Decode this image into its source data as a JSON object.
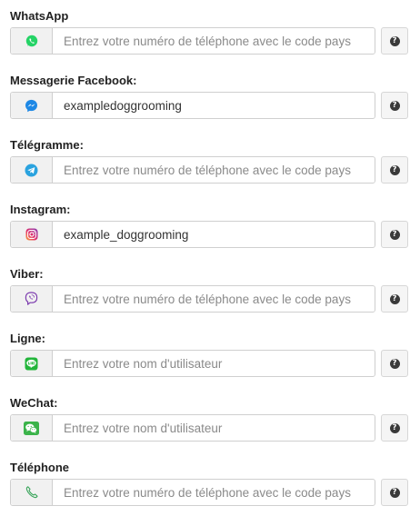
{
  "help_glyph": "?",
  "fields": [
    {
      "label": "WhatsApp",
      "icon": "whatsapp-icon",
      "icon_color": "#25D366",
      "value": "",
      "placeholder": "Entrez votre numéro de téléphone avec le code pays"
    },
    {
      "label": "Messagerie Facebook:",
      "icon": "messenger-icon",
      "icon_color": "#1E88E5",
      "value": "exampledoggrooming",
      "placeholder": ""
    },
    {
      "label": "Télégramme:",
      "icon": "telegram-icon",
      "icon_color": "#2AA3DF",
      "value": "",
      "placeholder": "Entrez votre numéro de téléphone avec le code pays"
    },
    {
      "label": "Instagram:",
      "icon": "instagram-icon",
      "icon_color": "#D6336C",
      "value": "example_doggrooming",
      "placeholder": ""
    },
    {
      "label": "Viber:",
      "icon": "viber-icon",
      "icon_color": "#7D3DAF",
      "value": "",
      "placeholder": "Entrez votre numéro de téléphone avec le code pays"
    },
    {
      "label": "Ligne:",
      "icon": "line-icon",
      "icon_color": "#22B53A",
      "value": "",
      "placeholder": "Entrez votre nom d'utilisateur"
    },
    {
      "label": "WeChat:",
      "icon": "wechat-icon",
      "icon_color": "#3BB34A",
      "value": "",
      "placeholder": "Entrez votre nom d'utilisateur"
    },
    {
      "label": "Téléphone",
      "icon": "phone-icon",
      "icon_color": "#3BA55C",
      "value": "",
      "placeholder": "Entrez votre numéro de téléphone avec le code pays"
    }
  ]
}
